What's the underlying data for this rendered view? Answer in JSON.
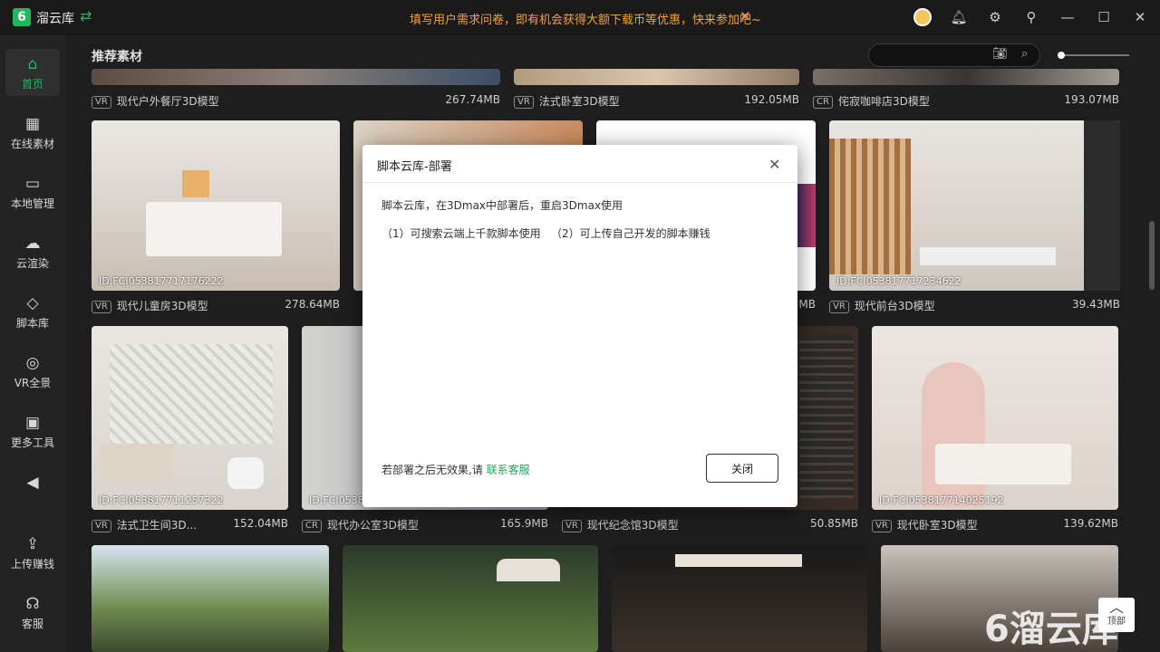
{
  "app": {
    "logo": "6",
    "name": "溜云库",
    "notice": "填写用户需求问卷，即有机会获得大额下载币等优惠，快来参加吧~"
  },
  "sidebar": {
    "items": [
      {
        "label": "首页",
        "icon": "home-icon",
        "glyph": "⌂"
      },
      {
        "label": "在线素材",
        "icon": "grid-icon",
        "glyph": "▦"
      },
      {
        "label": "本地管理",
        "icon": "monitor-icon",
        "glyph": "▭"
      },
      {
        "label": "云渲染",
        "icon": "cloud-icon",
        "glyph": "☁"
      },
      {
        "label": "脚本库",
        "icon": "code-icon",
        "glyph": "◇"
      },
      {
        "label": "VR全景",
        "icon": "vr-icon",
        "glyph": "◎"
      },
      {
        "label": "更多工具",
        "icon": "toolbox-icon",
        "glyph": "▣"
      },
      {
        "label": "",
        "icon": "collapse-icon",
        "glyph": "◀"
      },
      {
        "label": "上传赚钱",
        "icon": "upload-icon",
        "glyph": "⇪"
      },
      {
        "label": "客服",
        "icon": "headset-icon",
        "glyph": "☊"
      }
    ]
  },
  "main": {
    "section_title": "推荐素材",
    "search_placeholder": ""
  },
  "cards": [
    {
      "badge": "VR",
      "title": "现代户外餐厅3D模型",
      "size": "267.74MB",
      "id": ""
    },
    {
      "badge": "VR",
      "title": "法式卧室3D模型",
      "size": "192.05MB",
      "id": ""
    },
    {
      "badge": "CR",
      "title": "侘寂咖啡店3D模型",
      "size": "193.07MB",
      "id": ""
    },
    {
      "badge": "VR",
      "title": "现代儿童房3D模型",
      "size": "278.64MB",
      "id": "ID:FCI053817717176222"
    },
    {
      "badge": "",
      "title": "",
      "size": "",
      "id": ""
    },
    {
      "badge": "",
      "title": "",
      "size": "MB",
      "id": ""
    },
    {
      "badge": "VR",
      "title": "现代前台3D模型",
      "size": "39.43MB",
      "id": "ID:FCI053817717234622"
    },
    {
      "badge": "VR",
      "title": "法式卫生间3D...",
      "size": "152.04MB",
      "id": "ID:FCI053817711257322"
    },
    {
      "badge": "CR",
      "title": "现代办公室3D模型",
      "size": "165.9MB",
      "id": "ID:FCI05381"
    },
    {
      "badge": "VR",
      "title": "现代纪念馆3D模型",
      "size": "50.85MB",
      "id": ""
    },
    {
      "badge": "VR",
      "title": "现代卧室3D模型",
      "size": "139.62MB",
      "id": "ID:FCI053817714025192"
    }
  ],
  "dialog": {
    "title": "脚本云库-部署",
    "line1": "脚本云库，在3Dmax中部署后，重启3Dmax使用",
    "line2a": "（1）可搜索云端上千款脚本使用",
    "line2b": "（2）可上传自己开发的脚本赚钱",
    "footer_text": "若部署之后无效果,请 ",
    "footer_link": "联系客服",
    "close_button": "关闭"
  },
  "backtop": {
    "label": "顶部",
    "glyph": "︿"
  },
  "watermark": "6溜云库",
  "colors": {
    "accent": "#21b85d",
    "notice": "#f0a23a"
  }
}
